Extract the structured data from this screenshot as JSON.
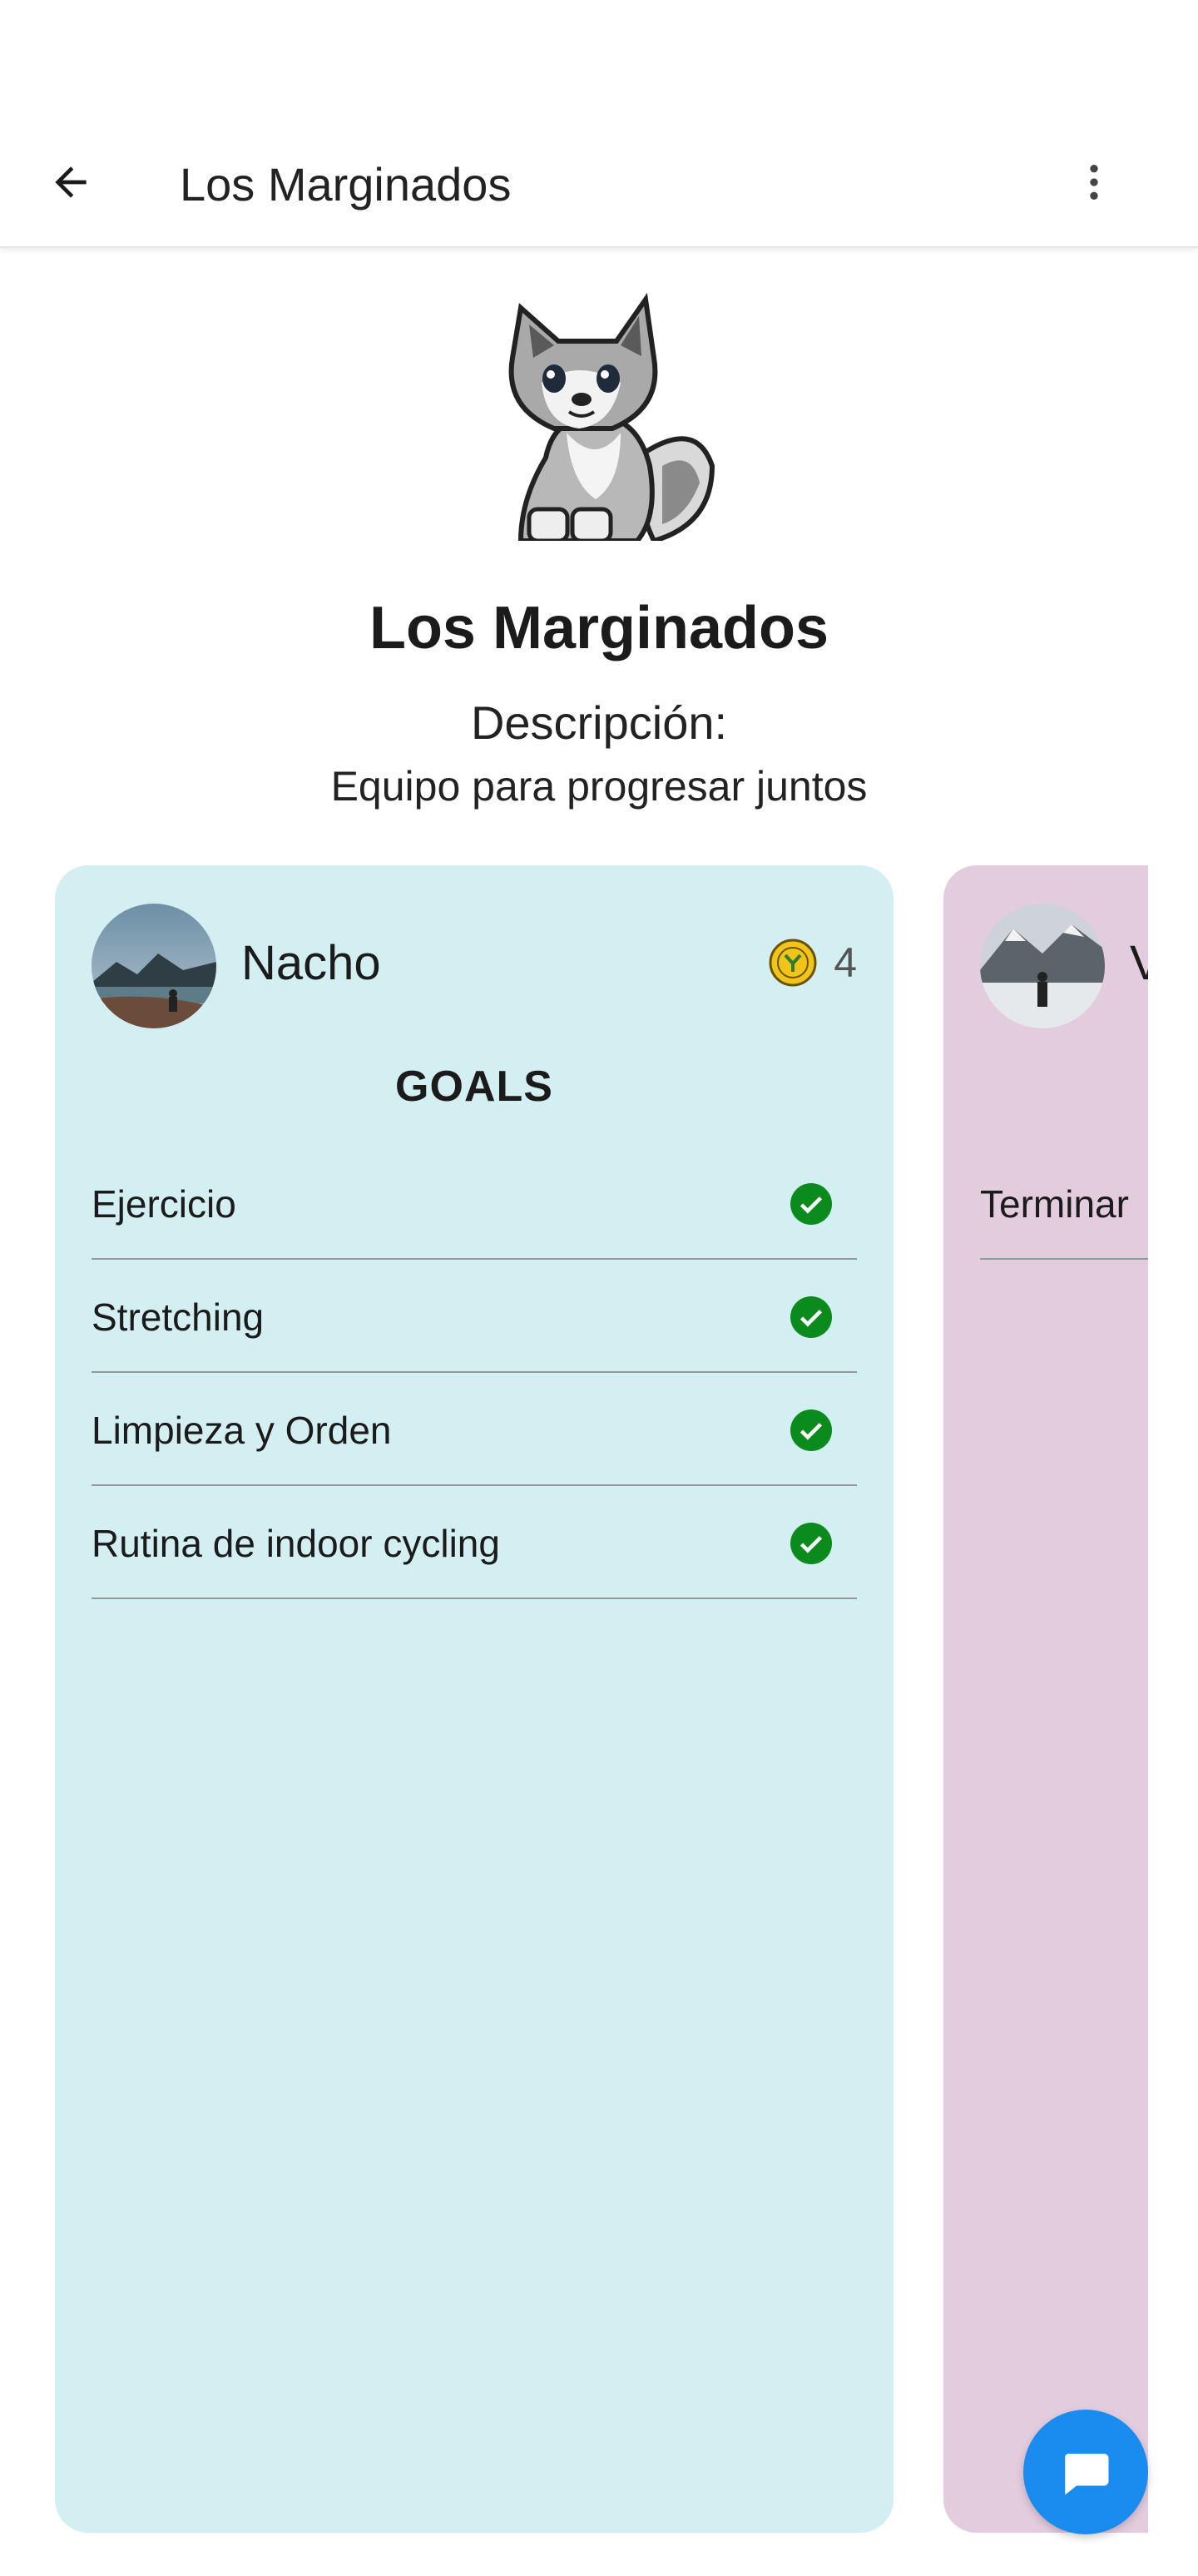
{
  "app_bar": {
    "title": "Los Marginados",
    "back_icon": "arrow-back-icon",
    "menu_icon": "more-vert-icon"
  },
  "team": {
    "name": "Los Marginados",
    "description_label": "Descripción:",
    "description": "Equipo para progresar juntos",
    "avatar_icon": "wolf-pixel-avatar"
  },
  "members": [
    {
      "name": "Nacho",
      "points": "4",
      "card_color": "#d3eff2",
      "goals_title": "GOALS",
      "goals": [
        {
          "label": "Ejercicio",
          "done": true
        },
        {
          "label": "Stretching",
          "done": true
        },
        {
          "label": "Limpieza y Orden",
          "done": true
        },
        {
          "label": "Rutina de indoor cycling",
          "done": true
        }
      ]
    },
    {
      "name": "V",
      "card_color": "#e4ccdf",
      "goals": [
        {
          "label": "Terminar",
          "done": false
        }
      ]
    }
  ],
  "colors": {
    "check": "#0b8a1e",
    "fab": "#1a8cf0",
    "coin": "#f0c419"
  },
  "fab": {
    "icon": "chat-bubble-icon"
  }
}
